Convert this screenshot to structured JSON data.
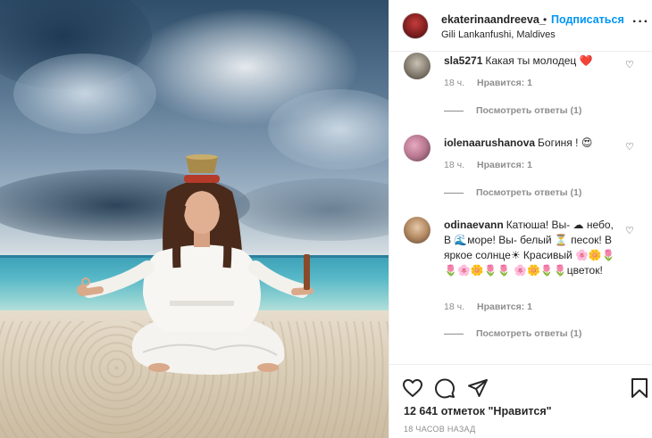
{
  "post": {
    "username": "ekaterinaandreeva_",
    "dot": "•",
    "follow_label": "Подписаться",
    "location": "Gili Lankanfushi, Maldives"
  },
  "comments": [
    {
      "username": "sla5271",
      "text": "Какая ты молодец",
      "emoji": "❤️",
      "time": "18 ч.",
      "likes": "Нравится: 1",
      "view_replies": "Посмотреть ответы (1)"
    },
    {
      "username": "iolenaarushanova",
      "text": "Богиня !",
      "emoji": "😍",
      "time": "18 ч.",
      "likes": "Нравится: 1",
      "view_replies": "Посмотреть ответы (1)"
    },
    {
      "username": "odinaevann",
      "text": "Катюша! Вы- ☁ небо, В 🌊море! Вы- белый ⏳ песок! В яркое солнце☀ Красивый 🌸🌼🌷🌷🌸🌼🌷🌷 🌸🌼🌷🌷цветок!",
      "time": "18 ч.",
      "likes": "Нравится: 1",
      "view_replies": "Посмотреть ответы (1)"
    }
  ],
  "footer": {
    "likes_count": "12 641 отметок \"Нравится\"",
    "time_ago": "18 ЧАСОВ НАЗАД"
  },
  "icons": {
    "more": "more-options-icon",
    "like": "heart-icon",
    "comment": "comment-icon",
    "share": "share-icon",
    "save": "bookmark-icon"
  },
  "colors": {
    "follow": "#0095f6",
    "muted": "#8e8e8e",
    "text": "#262626"
  }
}
